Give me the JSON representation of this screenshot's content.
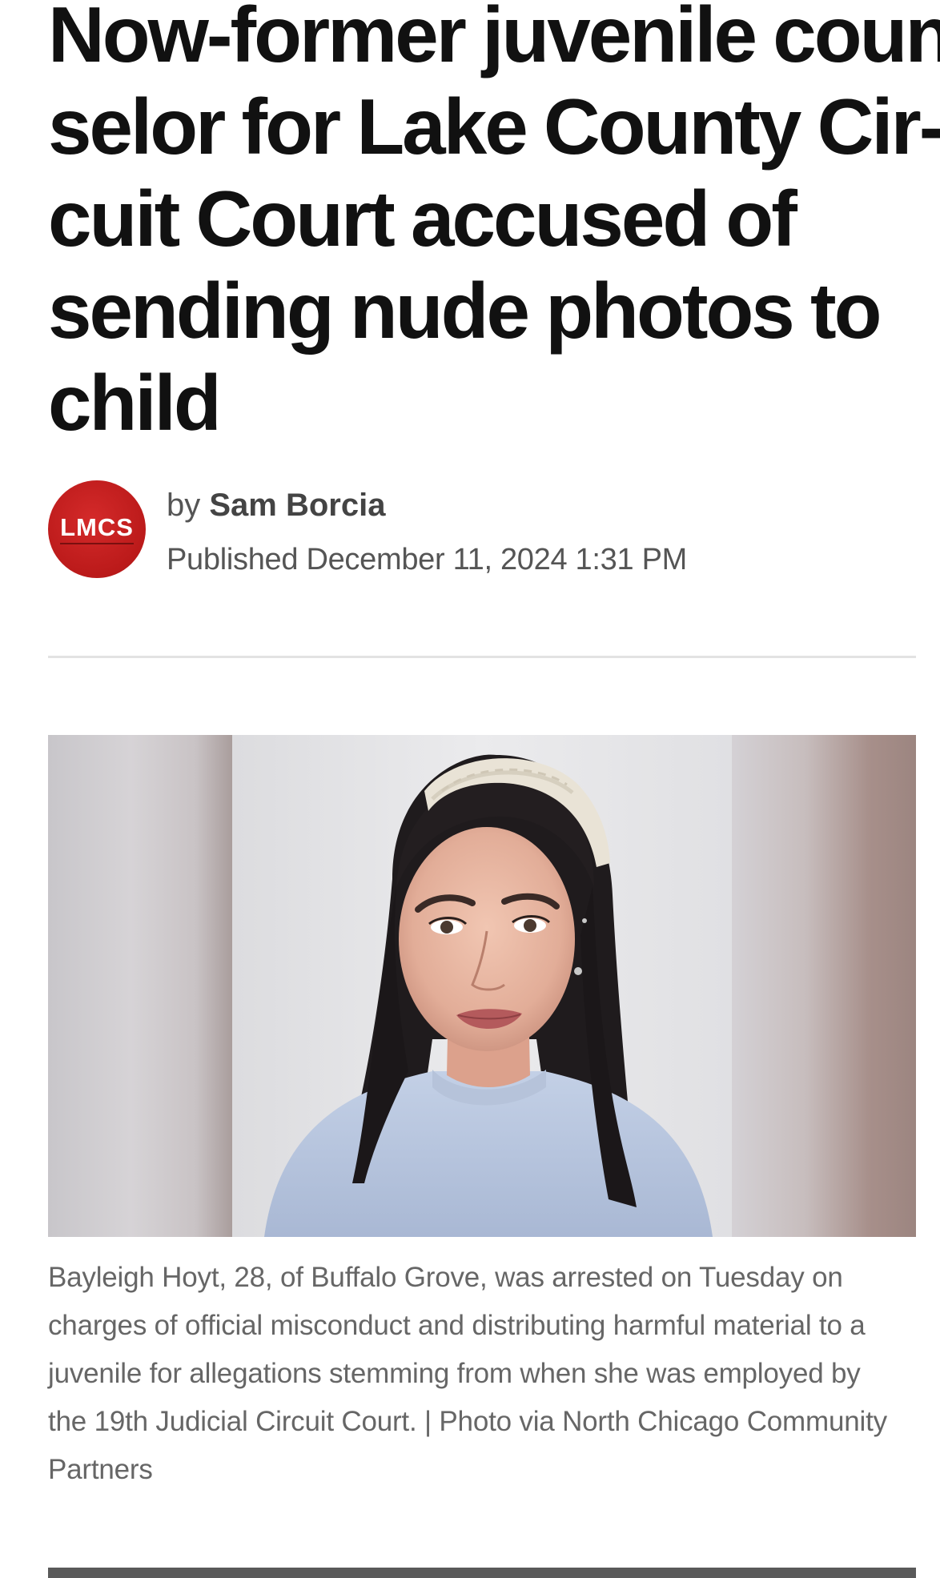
{
  "article": {
    "headline": "Now-former juvenile counselor for Lake County Circuit Court accused of sending nude photos to child",
    "headline_lines": [
      "Now-former juvenile coun-",
      "selor for Lake County Cir-",
      "cuit Court accused of",
      "sending nude photos to",
      "child"
    ],
    "byline": {
      "logo_text": "LMCS",
      "by_prefix": "by",
      "author": "Sam Borcia",
      "published": "Published December 11, 2024 1:31 PM"
    },
    "image": {
      "icon": "portrait-photo"
    },
    "caption_lines": [
      "Bayleigh Hoyt, 28, of Buffalo Grove, was arrested on Tuesday on",
      "charges of official misconduct and distributing harmful material to a",
      "juvenile for allegations stemming from when she was employed by",
      "the 19th Judicial Circuit Court. | Photo via North Chicago Community",
      "Partners"
    ]
  },
  "colors": {
    "logo_red": "#bb1a1a",
    "text_primary": "#111111",
    "text_secondary": "#555555",
    "caption": "#666666",
    "divider": "#e2e2e2"
  }
}
